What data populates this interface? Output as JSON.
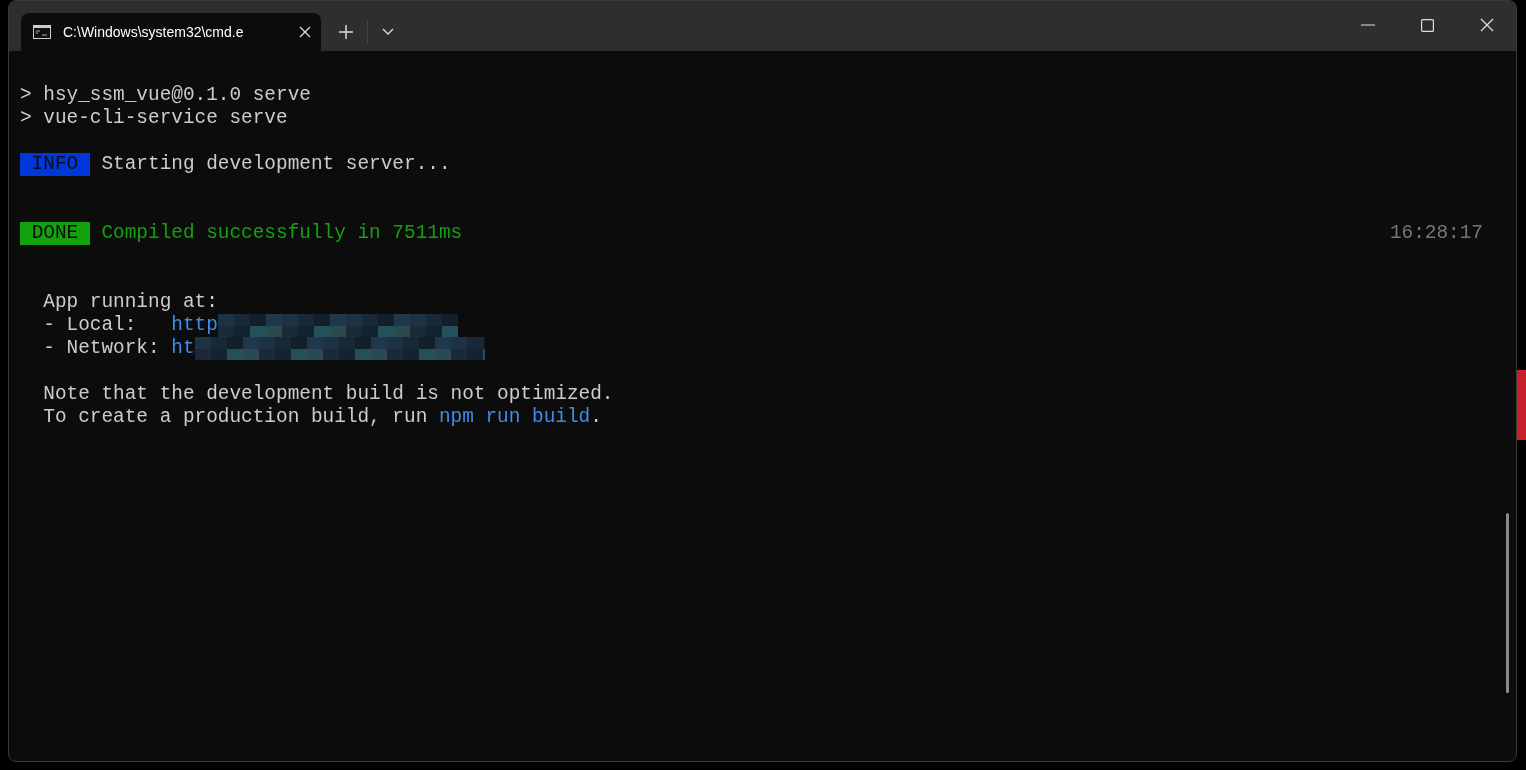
{
  "window": {
    "tab": {
      "title": "C:\\Windows\\system32\\cmd.e",
      "selected": true
    }
  },
  "terminal": {
    "lines": [
      {
        "kind": "blank"
      },
      {
        "kind": "text",
        "segments": [
          {
            "kind": "plain",
            "text": "> hsy_ssm_vue@0.1.0 serve"
          }
        ]
      },
      {
        "kind": "text",
        "segments": [
          {
            "kind": "plain",
            "text": "> vue-cli-service serve"
          }
        ]
      },
      {
        "kind": "blank"
      },
      {
        "kind": "text",
        "segments": [
          {
            "kind": "badge_info",
            "text": " INFO "
          },
          {
            "kind": "plain",
            "text": " Starting development server..."
          }
        ]
      },
      {
        "kind": "blank"
      },
      {
        "kind": "blank"
      },
      {
        "kind": "text",
        "segments": [
          {
            "kind": "badge_done",
            "text": " DONE "
          },
          {
            "kind": "success",
            "text": " Compiled successfully in 7511ms"
          },
          {
            "kind": "timestamp",
            "text": "16:28:17"
          }
        ]
      },
      {
        "kind": "blank"
      },
      {
        "kind": "blank"
      },
      {
        "kind": "text",
        "segments": [
          {
            "kind": "plain",
            "text": "  App running at:"
          }
        ]
      },
      {
        "kind": "text",
        "segments": [
          {
            "kind": "plain",
            "text": "  - Local:   "
          },
          {
            "kind": "link",
            "text": "http",
            "redacted": true
          }
        ]
      },
      {
        "kind": "text",
        "segments": [
          {
            "kind": "plain",
            "text": "  - Network: "
          },
          {
            "kind": "link",
            "text": "ht",
            "redacted": true
          }
        ]
      },
      {
        "kind": "blank"
      },
      {
        "kind": "text",
        "segments": [
          {
            "kind": "plain",
            "text": "  Note that the development build is not optimized."
          }
        ]
      },
      {
        "kind": "text",
        "segments": [
          {
            "kind": "plain",
            "text": "  To create a production build, run "
          },
          {
            "kind": "link",
            "text": "npm run build"
          },
          {
            "kind": "plain",
            "text": "."
          }
        ]
      }
    ]
  }
}
